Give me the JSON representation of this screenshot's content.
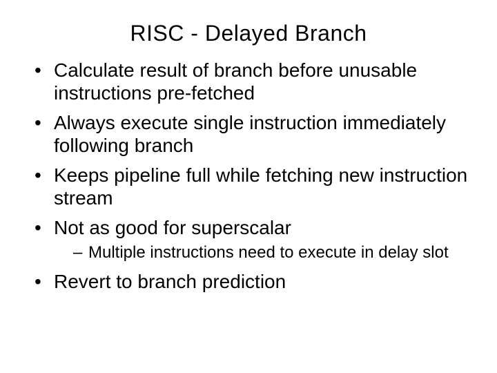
{
  "slide": {
    "title": "RISC - Delayed Branch",
    "bullets": {
      "b0": "Calculate result of branch before unusable instructions pre-fetched",
      "b1": "Always execute single instruction immediately following branch",
      "b2": "Keeps pipeline full while fetching new instruction stream",
      "b3": "Not as good for superscalar",
      "b3_sub0": "Multiple instructions need to execute in delay slot",
      "b4": "Revert to branch prediction"
    }
  }
}
